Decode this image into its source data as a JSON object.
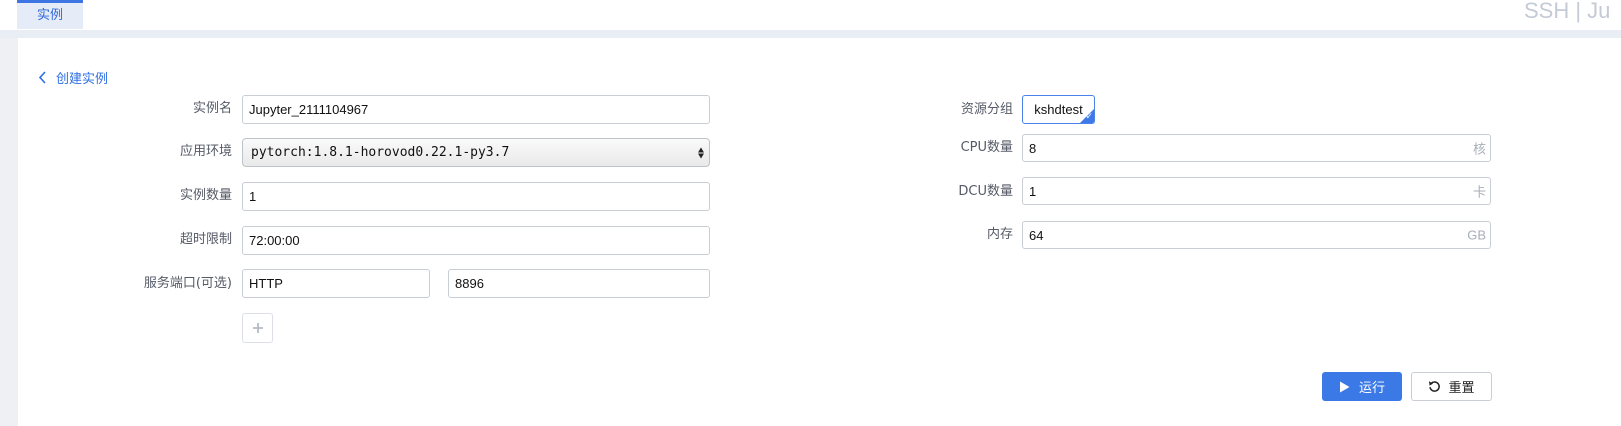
{
  "tabs": [
    {
      "label": "实例",
      "active": true
    }
  ],
  "header_right_text": "SSH | Ju",
  "colors": {
    "accent": "#3b79e6",
    "page_background": "#e9edf4",
    "panel_background": "#ffffff"
  },
  "page": {
    "back_label": "创建实例",
    "back_icon": "chevron-left-icon"
  },
  "form_left": {
    "instance_name": {
      "label": "实例名",
      "value": "Jupyter_2111104967"
    },
    "environment": {
      "label": "应用环境",
      "value": "pytorch:1.8.1-horovod0.22.1-py3.7"
    },
    "instance_count": {
      "label": "实例数量",
      "value": "1"
    },
    "timeout": {
      "label": "超时限制",
      "value": "72:00:00"
    },
    "service_port": {
      "label": "服务端口(可选)",
      "protocol": "HTTP",
      "port": "8896"
    },
    "add_icon": "plus-icon"
  },
  "form_right": {
    "resource_group": {
      "label": "资源分组",
      "value": "kshdtest"
    },
    "cpu": {
      "label": "CPU数量",
      "value": "8",
      "unit": "核"
    },
    "dcu": {
      "label": "DCU数量",
      "value": "1",
      "unit": "卡"
    },
    "memory": {
      "label": "内存",
      "value": "64",
      "unit": "GB"
    }
  },
  "actions": {
    "run_label": "运行",
    "run_icon": "play-icon",
    "reset_label": "重置",
    "reset_icon": "reset-icon"
  }
}
